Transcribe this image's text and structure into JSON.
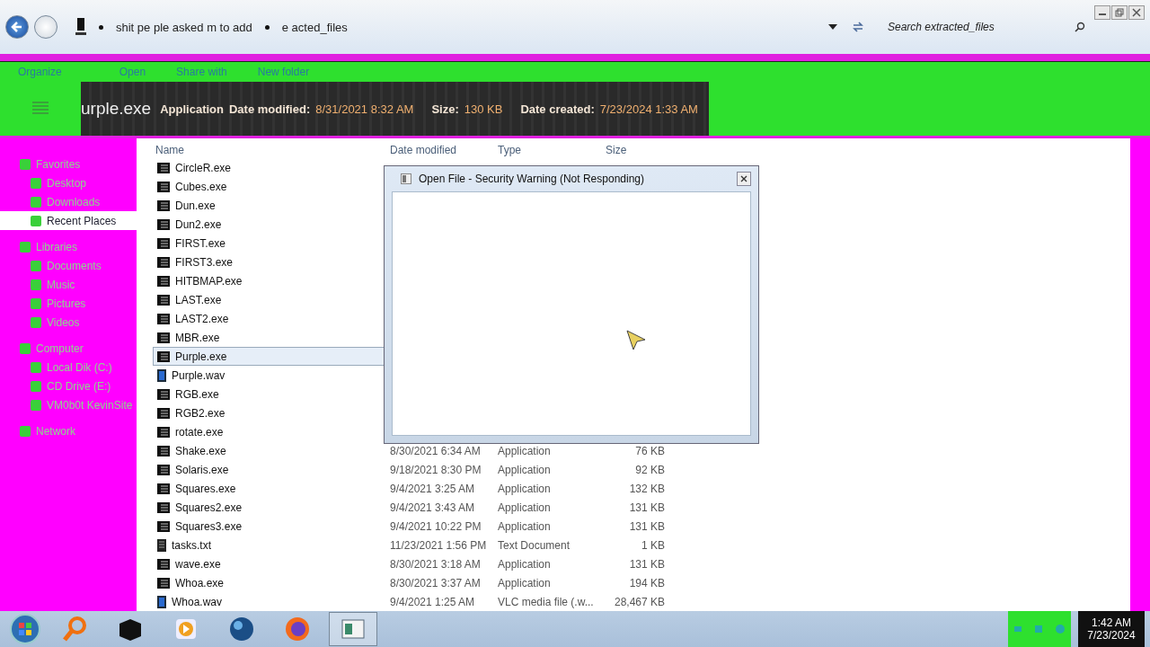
{
  "address_bar": {
    "breadcrumbs": [
      "shit pe ple asked m  to add",
      "e  acted_files"
    ]
  },
  "search": {
    "placeholder": "Search extracted_files"
  },
  "toolbar": {
    "items": [
      "Organize",
      "Open",
      "Share with",
      "New folder"
    ]
  },
  "details_pane": {
    "name": "urple.exe",
    "type": "Application",
    "fields": [
      {
        "label": "Date modified:",
        "value": "8/31/2021 8:32 AM"
      },
      {
        "label": "Size:",
        "value": "130 KB"
      },
      {
        "label": "Date created:",
        "value": "7/23/2024 1:33 AM"
      }
    ]
  },
  "sidebar": {
    "groups": [
      {
        "label": "Favorites",
        "children": [
          {
            "label": "Desktop",
            "selected": false
          },
          {
            "label": "Downloads",
            "selected": false
          },
          {
            "label": "Recent Places",
            "selected": true
          }
        ]
      },
      {
        "label": "Libraries",
        "children": [
          {
            "label": "Documents",
            "selected": false
          },
          {
            "label": "Music",
            "selected": false
          },
          {
            "label": "Pictures",
            "selected": false
          },
          {
            "label": "Videos",
            "selected": false
          }
        ]
      },
      {
        "label": "Computer",
        "children": [
          {
            "label": "Local Dik (C:)",
            "selected": false
          },
          {
            "label": "CD Drive (E:)",
            "selected": false
          },
          {
            "label": "VM0b0t KevinSite",
            "selected": false
          }
        ]
      },
      {
        "label": "Network"
      }
    ]
  },
  "table": {
    "columns": [
      "Name",
      "Date modified",
      "Type",
      "Size"
    ],
    "rows": [
      {
        "kind": "exe",
        "name": "CircleR.exe",
        "selected": false
      },
      {
        "kind": "exe",
        "name": "Cubes.exe",
        "selected": false
      },
      {
        "kind": "exe",
        "name": "Dun.exe",
        "selected": false
      },
      {
        "kind": "exe",
        "name": "Dun2.exe",
        "selected": false
      },
      {
        "kind": "exe",
        "name": "FIRST.exe",
        "selected": false
      },
      {
        "kind": "exe",
        "name": "FIRST3.exe",
        "selected": false
      },
      {
        "kind": "exe",
        "name": "HITBMAP.exe",
        "selected": false
      },
      {
        "kind": "exe",
        "name": "LAST.exe",
        "selected": false
      },
      {
        "kind": "exe",
        "name": "LAST2.exe",
        "selected": false
      },
      {
        "kind": "exe",
        "name": "MBR.exe",
        "selected": false
      },
      {
        "kind": "exe",
        "name": "Purple.exe",
        "selected": true
      },
      {
        "kind": "wav",
        "name": "Purple.wav",
        "selected": false
      },
      {
        "kind": "exe",
        "name": "RGB.exe",
        "selected": false
      },
      {
        "kind": "exe",
        "name": "RGB2.exe",
        "selected": false
      },
      {
        "kind": "exe",
        "name": "rotate.exe",
        "selected": false
      },
      {
        "kind": "exe",
        "name": "Shake.exe",
        "selected": false,
        "date": "8/30/2021 6:34 AM",
        "type": "Application",
        "size": "76 KB"
      },
      {
        "kind": "exe",
        "name": "Solaris.exe",
        "selected": false,
        "date": "9/18/2021 8:30 PM",
        "type": "Application",
        "size": "92 KB"
      },
      {
        "kind": "exe",
        "name": "Squares.exe",
        "selected": false,
        "date": "9/4/2021 3:25 AM",
        "type": "Application",
        "size": "132 KB"
      },
      {
        "kind": "exe",
        "name": "Squares2.exe",
        "selected": false,
        "date": "9/4/2021 3:43 AM",
        "type": "Application",
        "size": "131 KB"
      },
      {
        "kind": "exe",
        "name": "Squares3.exe",
        "selected": false,
        "date": "9/4/2021 10:22 PM",
        "type": "Application",
        "size": "131 KB"
      },
      {
        "kind": "txt",
        "name": "tasks.txt",
        "selected": false,
        "date": "11/23/2021 1:56 PM",
        "type": "Text Document",
        "size": "1 KB"
      },
      {
        "kind": "exe",
        "name": "wave.exe",
        "selected": false,
        "date": "8/30/2021 3:18 AM",
        "type": "Application",
        "size": "131 KB"
      },
      {
        "kind": "exe",
        "name": "Whoa.exe",
        "selected": false,
        "date": "8/30/2021 3:37 AM",
        "type": "Application",
        "size": "194 KB"
      },
      {
        "kind": "wav",
        "name": "Whoa.wav",
        "selected": false,
        "date": "9/4/2021 1:25 AM",
        "type": "VLC media file (.w...",
        "size": "28,467 KB"
      }
    ]
  },
  "dialog": {
    "title": "Open File - Security Warning (Not Responding)"
  },
  "taskbar": {
    "clock": {
      "time": "1:42 AM",
      "date": "7/23/2024"
    }
  }
}
